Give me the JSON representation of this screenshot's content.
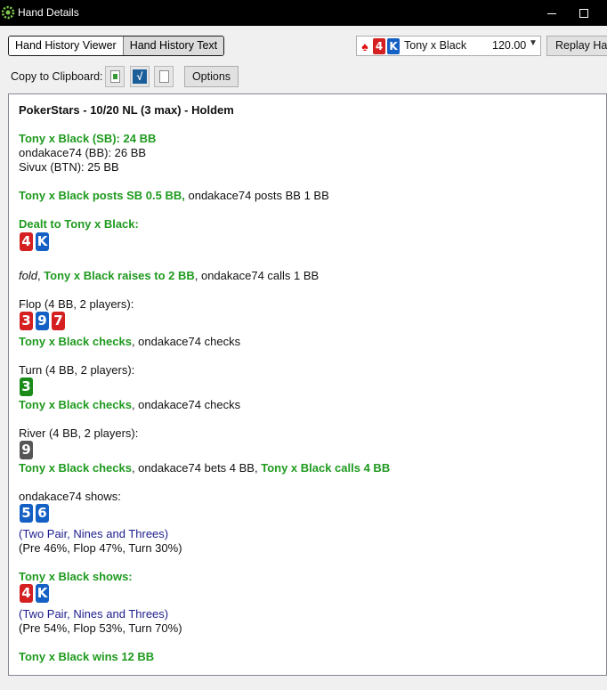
{
  "window": {
    "title": "Hand Details"
  },
  "tabs": [
    {
      "label": "Hand History Viewer",
      "active": false
    },
    {
      "label": "Hand History Text",
      "active": true
    }
  ],
  "player_select": {
    "cards": [
      {
        "rank": "4",
        "color": "red"
      },
      {
        "rank": "K",
        "color": "blue"
      }
    ],
    "name": "Tony x Black",
    "amount": "120.00"
  },
  "replay_button": "Replay Hand",
  "toolbar": {
    "copy_label": "Copy to Clipboard:",
    "options_label": "Options"
  },
  "hand": {
    "header": "PokerStars - 10/20 NL (3 max) - Holdem",
    "seats": [
      {
        "text": "Tony x Black (SB): 24 BB",
        "hero": true
      },
      {
        "text": "ondakace74 (BB): 26 BB",
        "hero": false
      },
      {
        "text": "Sivux (BTN): 25 BB",
        "hero": false
      }
    ],
    "blinds": {
      "hero": "Tony x Black posts SB 0.5 BB,",
      "other": " ondakace74 posts BB 1 BB"
    },
    "dealt": {
      "label": "Dealt to Tony x Black:",
      "cards": [
        {
          "rank": "4",
          "color": "red"
        },
        {
          "rank": "K",
          "color": "blue"
        }
      ]
    },
    "preflop": {
      "fold": "fold",
      "sep": ", ",
      "hero": "Tony x Black raises to 2 BB",
      "rest": ", ondakace74 calls 1 BB"
    },
    "flop": {
      "label": "Flop (4 BB, 2 players):",
      "cards": [
        {
          "rank": "3",
          "color": "red"
        },
        {
          "rank": "9",
          "color": "blue"
        },
        {
          "rank": "7",
          "color": "red"
        }
      ],
      "hero": "Tony x Black checks",
      "rest": ", ondakace74 checks"
    },
    "turn": {
      "label": "Turn (4 BB, 2 players):",
      "cards": [
        {
          "rank": "3",
          "color": "green"
        }
      ],
      "hero": "Tony x Black checks",
      "rest": ", ondakace74 checks"
    },
    "river": {
      "label": "River (4 BB, 2 players):",
      "cards": [
        {
          "rank": "9",
          "color": "gray"
        }
      ],
      "hero": "Tony x Black checks",
      "mid": ", ondakace74 bets 4 BB, ",
      "hero2": "Tony x Black calls 4 BB"
    },
    "villain_shows": {
      "label": "ondakace74 shows:",
      "cards": [
        {
          "rank": "5",
          "color": "blue"
        },
        {
          "rank": "6",
          "color": "blue"
        }
      ],
      "hand": "(Two Pair, Nines and Threes)",
      "equity": "(Pre 46%, Flop 47%, Turn 30%)"
    },
    "hero_shows": {
      "label": "Tony x Black shows:",
      "cards": [
        {
          "rank": "4",
          "color": "red"
        },
        {
          "rank": "K",
          "color": "blue"
        }
      ],
      "hand": "(Two Pair, Nines and Threes)",
      "equity": "(Pre 54%, Flop 53%, Turn 70%)"
    },
    "result": "Tony x Black wins 12 BB"
  }
}
